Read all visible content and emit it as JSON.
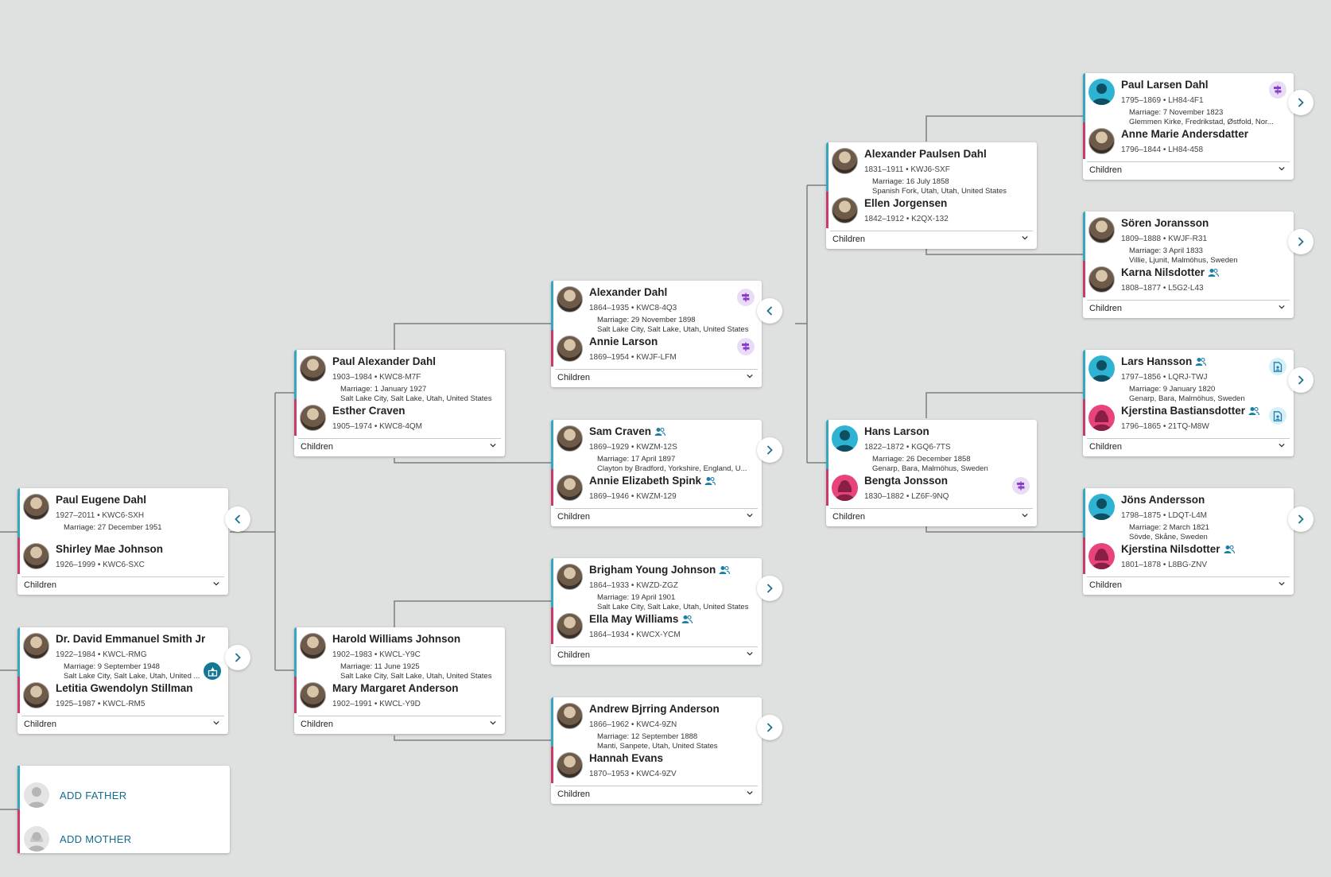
{
  "children_label": "Children",
  "add_father": "ADD FATHER",
  "add_mother": "ADD MOTHER",
  "couples": [
    {
      "id": "c1",
      "husband": {
        "name": "Paul Eugene Dahl",
        "meta": "1927–2011 • KWC6-SXH",
        "avatar": "photo"
      },
      "marriage": [
        "Marriage: 27 December 1951"
      ],
      "wife": {
        "name": "Shirley Mae Johnson",
        "meta": "1926–1999 • KWC6-SXC",
        "avatar": "photo"
      }
    },
    {
      "id": "c2",
      "husband": {
        "name": "Dr. David Emmanuel Smith Jr",
        "meta": "1922–1984 • KWCL-RMG",
        "avatar": "photo"
      },
      "marriage": [
        "Marriage: 9 September 1948",
        "Salt Lake City, Salt Lake, Utah, United ..."
      ],
      "wife": {
        "name": "Letitia Gwendolyn Stillman",
        "meta": "1925–1987 • KWCL-RM5",
        "avatar": "photo"
      }
    },
    {
      "id": "c3",
      "husband": {
        "name": "Paul Alexander Dahl",
        "meta": "1903–1984 • KWC8-M7F",
        "avatar": "photo"
      },
      "marriage": [
        "Marriage: 1 January 1927",
        "Salt Lake City, Salt Lake, Utah, United States"
      ],
      "wife": {
        "name": "Esther Craven",
        "meta": "1905–1974 • KWC8-4QM",
        "avatar": "photo"
      }
    },
    {
      "id": "c4",
      "husband": {
        "name": "Harold Williams Johnson",
        "meta": "1902–1983 • KWCL-Y9C",
        "avatar": "photo"
      },
      "marriage": [
        "Marriage: 11 June 1925",
        "Salt Lake City, Salt Lake, Utah, United States"
      ],
      "wife": {
        "name": "Mary Margaret Anderson",
        "meta": "1902–1991 • KWCL-Y9D",
        "avatar": "photo"
      }
    },
    {
      "id": "c5",
      "husband": {
        "name": "Alexander Dahl",
        "meta": "1864–1935 • KWC8-4Q3",
        "avatar": "photo"
      },
      "marriage": [
        "Marriage: 29 November 1898",
        "Salt Lake City, Salt Lake, Utah, United States"
      ],
      "wife": {
        "name": "Annie Larson",
        "meta": "1869–1954 • KWJF-LFM",
        "avatar": "photo"
      }
    },
    {
      "id": "c6",
      "husband": {
        "name": "Sam Craven",
        "meta": "1869–1929 • KWZM-12S",
        "avatar": "photo"
      },
      "marriage": [
        "Marriage: 17 April 1897",
        "Clayton by Bradford, Yorkshire, England, U..."
      ],
      "wife": {
        "name": "Annie Elizabeth Spink",
        "meta": "1869–1946 • KWZM-129",
        "avatar": "photo"
      }
    },
    {
      "id": "c7",
      "husband": {
        "name": "Brigham Young Johnson",
        "meta": "1864–1933 • KWZD-ZGZ",
        "avatar": "photo"
      },
      "marriage": [
        "Marriage: 19 April 1901",
        "Salt Lake City, Salt Lake, Utah, United States"
      ],
      "wife": {
        "name": "Ella May Williams",
        "meta": "1864–1934 • KWCX-YCM",
        "avatar": "photo"
      }
    },
    {
      "id": "c8",
      "husband": {
        "name": "Andrew Bjrring Anderson",
        "meta": "1866–1962 • KWC4-9ZN",
        "avatar": "photo"
      },
      "marriage": [
        "Marriage: 12 September 1888",
        "Manti, Sanpete, Utah, United States"
      ],
      "wife": {
        "name": "Hannah Evans",
        "meta": "1870–1953 • KWC4-9ZV",
        "avatar": "photo"
      }
    },
    {
      "id": "c9",
      "husband": {
        "name": "Alexander Paulsen Dahl",
        "meta": "1831–1911 • KWJ6-SXF",
        "avatar": "photo"
      },
      "marriage": [
        "Marriage: 16 July 1858",
        "Spanish Fork, Utah, Utah, United States"
      ],
      "wife": {
        "name": "Ellen Jorgensen",
        "meta": "1842–1912 • K2QX-132",
        "avatar": "photo"
      }
    },
    {
      "id": "c10",
      "husband": {
        "name": "Hans Larson",
        "meta": "1822–1872 • KGQ6-7TS",
        "avatar": "blue"
      },
      "marriage": [
        "Marriage: 26 December 1858",
        "Genarp, Bara, Malmöhus, Sweden"
      ],
      "wife": {
        "name": "Bengta Jonsson",
        "meta": "1830–1882 • LZ6F-9NQ",
        "avatar": "pink"
      }
    },
    {
      "id": "c11",
      "husband": {
        "name": "Paul Larsen Dahl",
        "meta": "1795–1869 • LH84-4F1",
        "avatar": "blue"
      },
      "marriage": [
        "Marriage: 7 November 1823",
        "Glemmen Kirke, Fredrikstad, Østfold, Nor..."
      ],
      "wife": {
        "name": "Anne Marie Andersdatter",
        "meta": "1796–1844 • LH84-458",
        "avatar": "photo"
      }
    },
    {
      "id": "c12",
      "husband": {
        "name": "Sören Joransson",
        "meta": "1809–1888 • KWJF-R31",
        "avatar": "photo"
      },
      "marriage": [
        "Marriage: 3 April 1833",
        "Villie, Ljunit, Malmöhus, Sweden"
      ],
      "wife": {
        "name": "Karna Nilsdotter",
        "meta": "1808–1877 • L5G2-L43",
        "avatar": "photo"
      }
    },
    {
      "id": "c13",
      "husband": {
        "name": "Lars Hansson",
        "meta": "1797–1856 • LQRJ-TWJ",
        "avatar": "blue"
      },
      "marriage": [
        "Marriage: 9 January 1820",
        "Genarp, Bara, Malmöhus, Sweden"
      ],
      "wife": {
        "name": "Kjerstina Bastiansdotter",
        "meta": "1796–1865 • 21TQ-M8W",
        "avatar": "pink"
      }
    },
    {
      "id": "c14",
      "husband": {
        "name": "Jöns Andersson",
        "meta": "1798–1875 • LDQT-L4M",
        "avatar": "blue"
      },
      "marriage": [
        "Marriage: 2 March 1821",
        "Sövde, Skåne, Sweden"
      ],
      "wife": {
        "name": "Kjerstina Nilsdotter",
        "meta": "1801–1878 • L8BG-ZNV",
        "avatar": "pink"
      }
    }
  ]
}
